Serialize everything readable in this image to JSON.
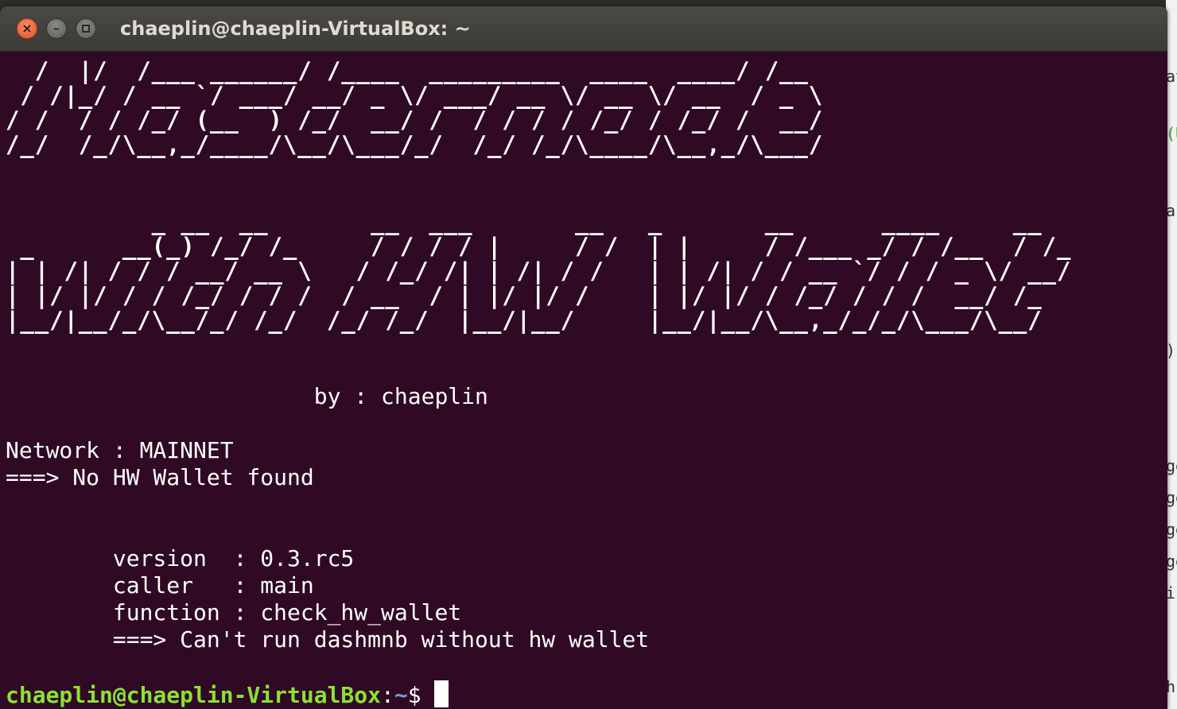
{
  "window": {
    "title": "chaeplin@chaeplin-VirtualBox: ~"
  },
  "banner": {
    "ascii_title": "  /  |/  /___ ______/ /____  _________  ____  ____/ /__\n / /|_/ / __ `/ ___/ __/ _ \\/ ___/ __ \\/ __ \\/ __  / _ \\\n/ /  / / /_/ (__  ) /_/  __/ /  / / / / /_/ / /_/ /  __/\n/_/  /_/\\__,_/____/\\__/\\___/_/  /_/ /_/\\____/\\__,_/\\___/",
    "ascii_subtitle": "          _ __  __       __  ___       __   _       __      ____     __\n _      __(_) /_/ /_     / / / / |     / /  | |     / /___ _/ / /__  / /_\n| | /| / / / __/ __ \\   / /_/ /| | /| / /   | | /| / / __ `/ / / _ \\/ __/\n| |/ |/ / / /_/ / / /  / __  / | |/ |/ /    | |/ |/ / /_/ / / /  __/ /_\n|__/|__/_/\\__/_/ /_/  /_/ /_/  |__/|__/     |__/|__/\\__,_/_/_/\\___/\\__/",
    "byline": "                       by : chaeplin"
  },
  "output": {
    "network_line": "Network : MAINNET",
    "hw_status_line": "===> No HW Wallet found",
    "version_line": "        version  : 0.3.rc5",
    "caller_line": "        caller   : main",
    "function_line": "        function : check_hw_wallet",
    "error_line": "        ===> Can't run dashmnb without hw wallet"
  },
  "prompt": {
    "user_host": "chaeplin@chaeplin-VirtualBox",
    "separator": ":",
    "path": "~",
    "symbol": "$"
  },
  "background_window": {
    "fragments": [
      "at",
      "(U",
      "ar",
      ")",
      "ge",
      "ge",
      "ge",
      "ge",
      "i",
      "h"
    ]
  },
  "colors": {
    "terminal_bg": "#300a24",
    "prompt_user": "#8ae234",
    "prompt_path": "#729fcf",
    "text": "#ffffff"
  }
}
